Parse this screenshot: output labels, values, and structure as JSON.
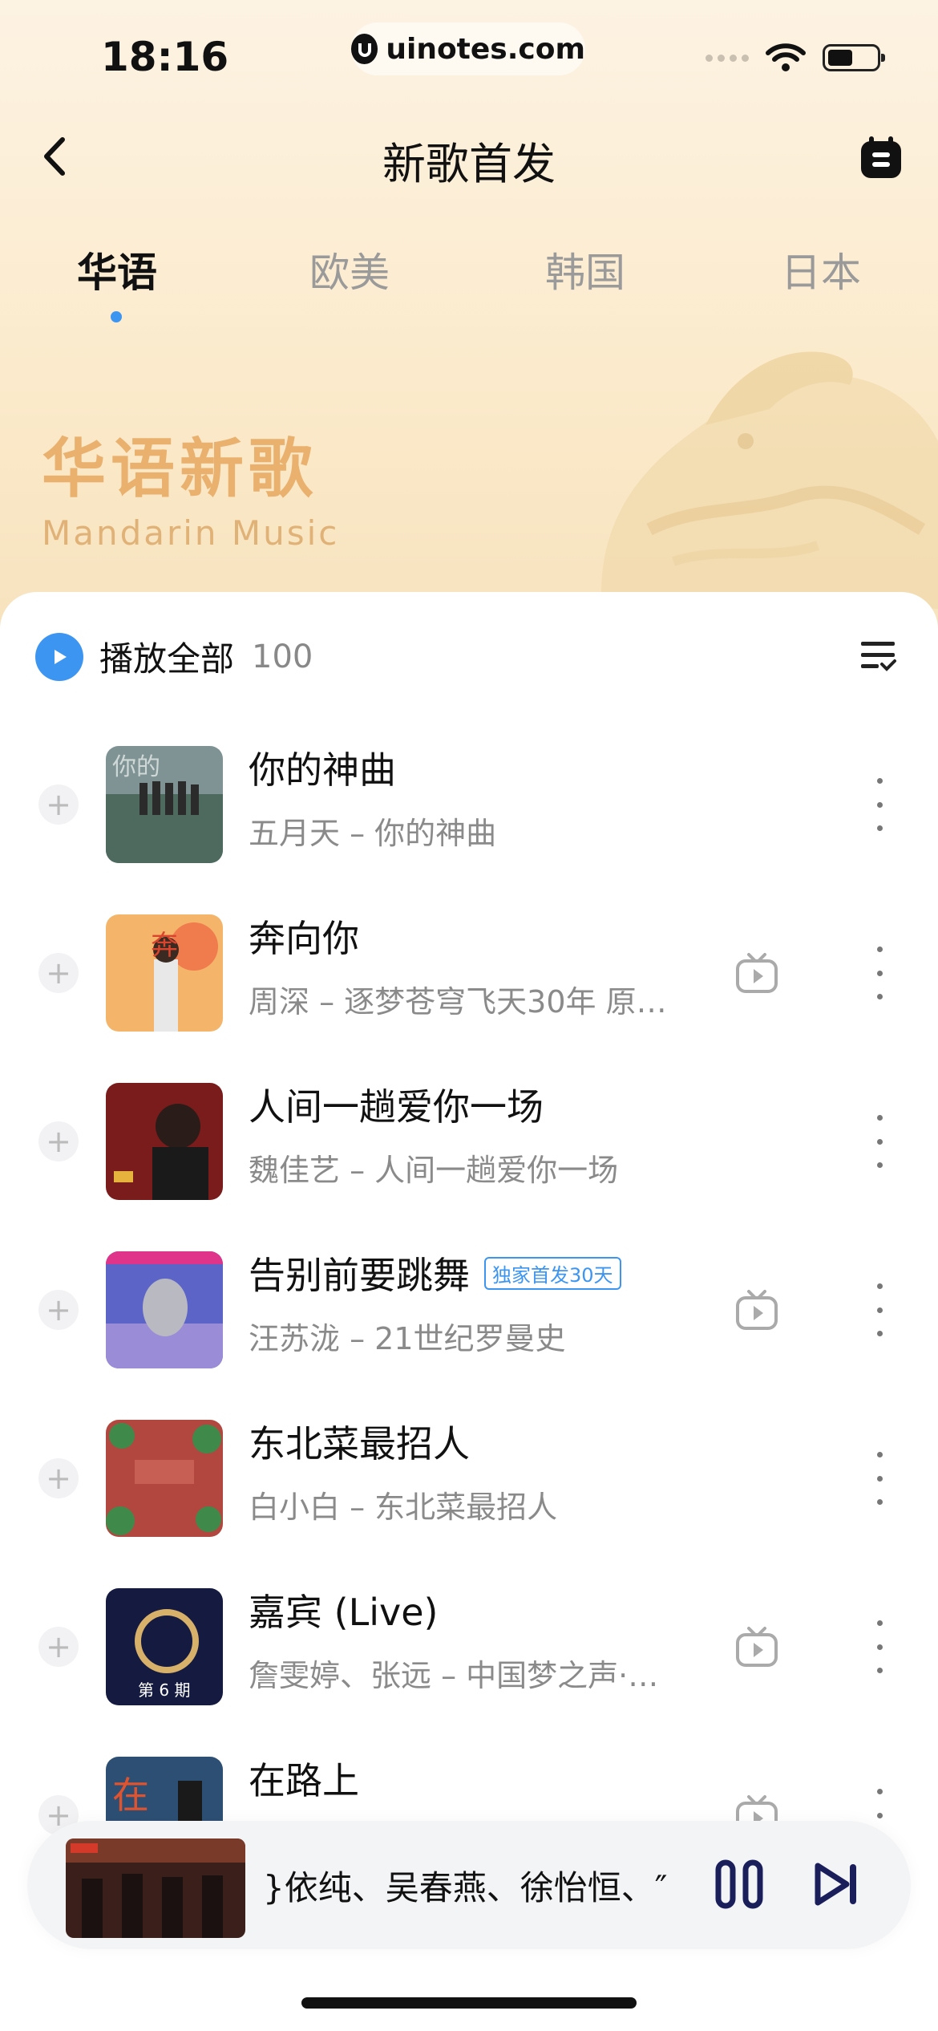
{
  "status_bar": {
    "time": "18:16",
    "url": "uinotes.com",
    "battery_level": 0.45
  },
  "nav": {
    "title": "新歌首发",
    "back_icon": "chevron-left-icon",
    "calendar_icon": "calendar-icon"
  },
  "tabs": [
    {
      "label": "华语",
      "active": true
    },
    {
      "label": "欧美",
      "active": false
    },
    {
      "label": "韩国",
      "active": false
    },
    {
      "label": "日本",
      "active": false
    }
  ],
  "hero": {
    "title": "华语新歌",
    "subtitle": "Mandarin Music"
  },
  "play_all": {
    "label": "播放全部",
    "count": "100"
  },
  "songs": [
    {
      "title": "你的神曲",
      "subtitle": "五月天 – 你的神曲",
      "has_mv": false,
      "badge": ""
    },
    {
      "title": "奔向你",
      "subtitle": "周深 – 逐梦苍穹飞天30年 原…",
      "has_mv": true,
      "badge": ""
    },
    {
      "title": "人间一趟爱你一场",
      "subtitle": "魏佳艺 – 人间一趟爱你一场",
      "has_mv": false,
      "badge": ""
    },
    {
      "title": "告别前要跳舞",
      "subtitle": "汪苏泷 – 21世纪罗曼史",
      "has_mv": true,
      "badge": "独家首发30天"
    },
    {
      "title": "东北菜最招人",
      "subtitle": "白小白 – 东北菜最招人",
      "has_mv": false,
      "badge": ""
    },
    {
      "title": "嘉宾 (Live)",
      "subtitle": "詹雯婷、张远 – 中国梦之声·…",
      "has_mv": true,
      "badge": ""
    },
    {
      "title": "在路上",
      "subtitle": "",
      "has_mv": true,
      "badge": ""
    }
  ],
  "player": {
    "now_playing": "}依纯、吴春燕、徐怡恒、″",
    "pause_icon": "pause-icon",
    "next_icon": "skip-next-icon"
  },
  "colors": {
    "accent": "#3d95f2",
    "hero_title": "#e9b06e"
  }
}
